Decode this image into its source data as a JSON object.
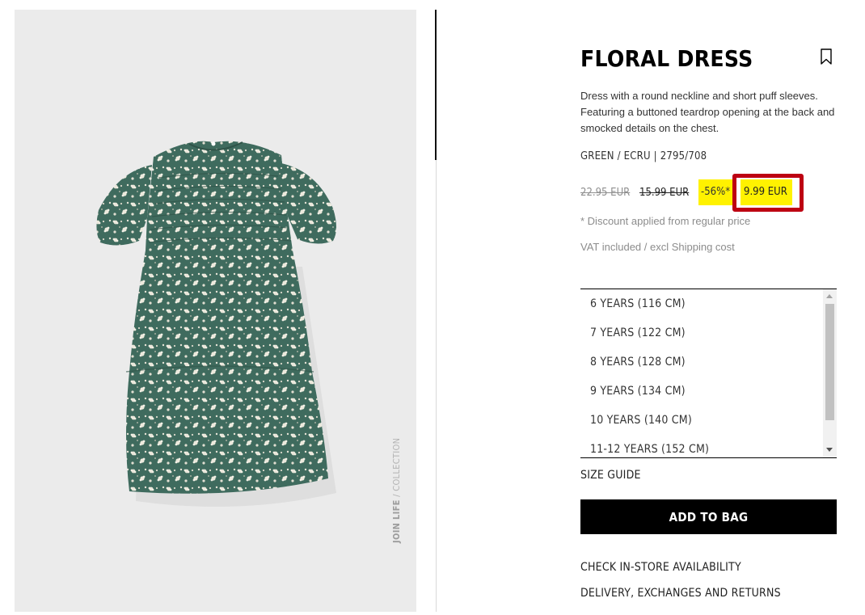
{
  "product": {
    "title": "FLORAL DRESS",
    "description": "Dress with a round neckline and short puff sleeves. Featuring a buttoned teardrop opening at the back and smocked details on the chest.",
    "color_ref": "GREEN / ECRU | 2795/708",
    "price": {
      "original": "22.95 EUR",
      "previous": "15.99 EUR",
      "discount": "-56%*",
      "current": "9.99 EUR"
    },
    "discount_note": "* Discount applied from regular price",
    "vat_note": "VAT included / excl Shipping cost"
  },
  "image": {
    "tag_bold": "JOIN LIFE",
    "tag_rest": " / COLLECTION",
    "icon": "floral-dress-photo"
  },
  "sizes": [
    "6 YEARS (116 CM)",
    "7 YEARS (122 CM)",
    "8 YEARS (128 CM)",
    "9 YEARS (134 CM)",
    "10 YEARS (140 CM)",
    "11-12 YEARS (152 CM)"
  ],
  "actions": {
    "size_guide": "SIZE GUIDE",
    "add_to_bag": "ADD TO BAG",
    "check_store": "CHECK IN-STORE AVAILABILITY",
    "delivery": "DELIVERY, EXCHANGES AND RETURNS"
  },
  "icons": {
    "bookmark": "bookmark-icon",
    "scroll_up": "scroll-up-arrow-icon",
    "scroll_down": "scroll-down-arrow-icon"
  },
  "colors": {
    "highlight": "#fff200",
    "annotation_border": "#bd0012",
    "button": "#000000",
    "dress_green": "#3f6b5e"
  }
}
